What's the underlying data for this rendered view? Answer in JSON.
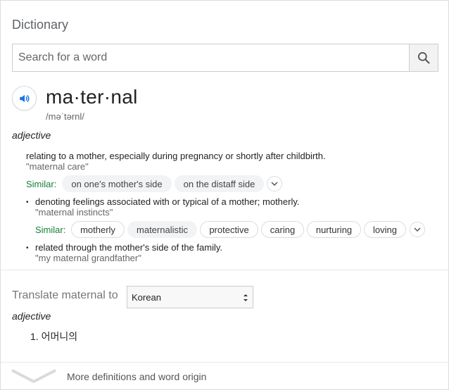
{
  "header": {
    "title": "Dictionary"
  },
  "search": {
    "placeholder": "Search for a word",
    "value": ""
  },
  "entry": {
    "word": "ma·ter·nal",
    "phonetic": "/məˈtərnl/",
    "part_of_speech": "adjective",
    "senses": [
      {
        "definition": "relating to a mother, especially during pregnancy or shortly after childbirth.",
        "example": "\"maternal care\"",
        "similar_label": "Similar:",
        "similar": [
          "on one's mother's side",
          "on the distaff side"
        ]
      },
      {
        "bullet": "•",
        "definition": "denoting feelings associated with or typical of a mother; motherly.",
        "example": "\"maternal instincts\"",
        "similar_label": "Similar:",
        "similar": [
          "motherly",
          "maternalistic",
          "protective",
          "caring",
          "nurturing",
          "loving"
        ]
      },
      {
        "bullet": "•",
        "definition": "related through the mother's side of the family.",
        "example": "\"my maternal grandfather\""
      }
    ]
  },
  "translate": {
    "label": "Translate maternal to",
    "language": "Korean",
    "part_of_speech": "adjective",
    "results": [
      {
        "number": "1.",
        "text": "어머니의"
      }
    ]
  },
  "footer": {
    "more_label": "More definitions and word origin"
  },
  "colors": {
    "accent": "#1a73e8",
    "similar_label": "#188038",
    "chip_bg": "#f1f3f4"
  },
  "icons": {
    "search": "search-icon",
    "speaker": "speaker-icon",
    "expand": "chevron-down-icon",
    "select": "updown-arrows-icon",
    "more": "chevron-down-icon"
  }
}
